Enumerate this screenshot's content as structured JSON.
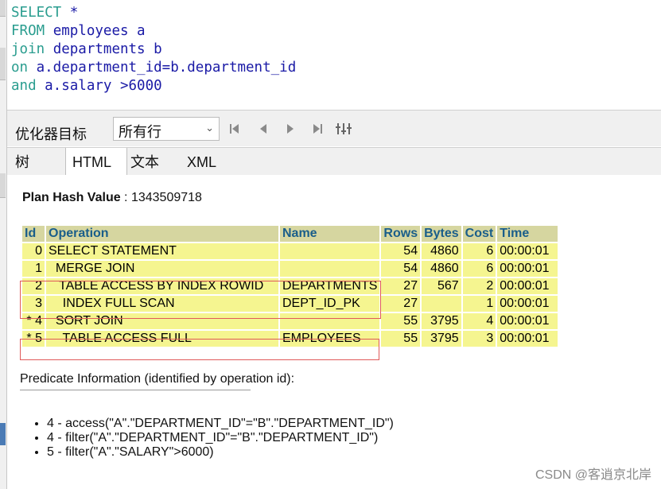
{
  "editor": {
    "lines": [
      {
        "kw": "SELECT",
        "rest": " *"
      },
      {
        "kw": "FROM",
        "rest": " employees a"
      },
      {
        "kw": "join",
        "rest": " departments b"
      },
      {
        "kw": "on",
        "rest": " a.department_id=b.department_id"
      },
      {
        "kw": "and",
        "rest": " a.salary >6000"
      }
    ]
  },
  "toolbar": {
    "optimizer_label": "优化器目标",
    "optimizer_value": "所有行",
    "icons": [
      "first-icon",
      "prev-icon",
      "next-icon",
      "last-icon",
      "columns-icon"
    ]
  },
  "tabs": [
    "树",
    "HTML",
    "文本",
    "XML"
  ],
  "active_tab": "HTML",
  "plan": {
    "hash_label": "Plan Hash Value",
    "hash_value": "1343509718",
    "headers": [
      "Id",
      "Operation",
      "Name",
      "Rows",
      "Bytes",
      "Cost",
      "Time"
    ],
    "rows": [
      [
        "0",
        "SELECT STATEMENT",
        "",
        "54",
        "4860",
        "6",
        "00:00:01"
      ],
      [
        "1",
        "  MERGE JOIN",
        "",
        "54",
        "4860",
        "6",
        "00:00:01"
      ],
      [
        "2",
        "   TABLE ACCESS BY INDEX ROWID",
        "DEPARTMENTS",
        "27",
        "567",
        "2",
        "00:00:01"
      ],
      [
        "3",
        "    INDEX FULL SCAN",
        "DEPT_ID_PK",
        "27",
        "",
        "1",
        "00:00:01"
      ],
      [
        "* 4",
        "  SORT JOIN",
        "",
        "55",
        "3795",
        "4",
        "00:00:01"
      ],
      [
        "* 5",
        "    TABLE ACCESS FULL",
        "EMPLOYEES",
        "55",
        "3795",
        "3",
        "00:00:01"
      ]
    ]
  },
  "predicate": {
    "title": "Predicate Information (identified by operation id):",
    "items": [
      "4 - access(\"A\".\"DEPARTMENT_ID\"=\"B\".\"DEPARTMENT_ID\")",
      "4 - filter(\"A\".\"DEPARTMENT_ID\"=\"B\".\"DEPARTMENT_ID\")",
      "5 - filter(\"A\".\"SALARY\">6000)"
    ]
  },
  "watermark": "CSDN @客逍京北岸"
}
